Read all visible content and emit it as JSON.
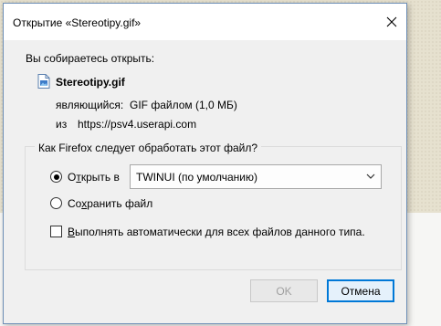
{
  "window": {
    "title": "Открытие «Stereotipy.gif»",
    "close_icon": "close-icon"
  },
  "intro": {
    "text": "Вы собираетесь открыть:"
  },
  "file": {
    "icon": "gif-file-icon",
    "name": "Stereotipy.gif",
    "type_label": "являющийся:",
    "type_value": "GIF файлом (1,0 МБ)",
    "from_label": "из",
    "from_value": "https://psv4.userapi.com"
  },
  "action_group": {
    "legend": "Как Firefox следует обработать этот файл?",
    "open_with": {
      "label_before": "О",
      "label_accel": "т",
      "label_after": "крыть в",
      "checked": true
    },
    "app_select": {
      "value": "TWINUI (по умолчанию)"
    },
    "save_file": {
      "label_before": "Со",
      "label_accel": "х",
      "label_after": "ранить файл",
      "checked": false
    },
    "auto": {
      "label_accel": "В",
      "label_after": "ыполнять автоматически для всех файлов данного типа.",
      "checked": false
    }
  },
  "buttons": {
    "ok": "OK",
    "cancel": "Отмена"
  },
  "colors": {
    "dialog_bg": "#f0f0f0",
    "titlebar_bg": "#ffffff",
    "border_accent": "#0078d7",
    "disabled_text": "#a0a0a0"
  }
}
